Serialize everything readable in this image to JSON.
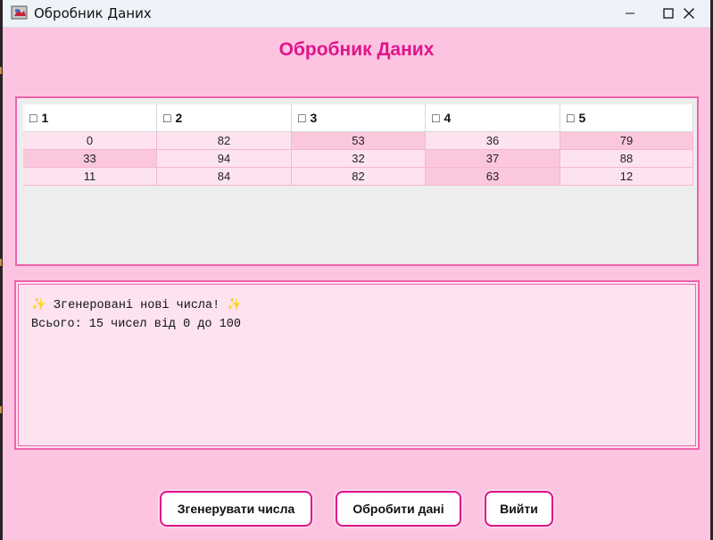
{
  "window": {
    "title": "Обробник Даних",
    "controls": [
      "minimize",
      "maximize",
      "close"
    ]
  },
  "heading": "Обробник Даних",
  "table": {
    "columns": [
      {
        "icon": "□",
        "label": "1"
      },
      {
        "icon": "□",
        "label": "2"
      },
      {
        "icon": "□",
        "label": "3"
      },
      {
        "icon": "□",
        "label": "4"
      },
      {
        "icon": "□",
        "label": "5"
      }
    ],
    "rows": [
      [
        "0",
        "82",
        "53",
        "36",
        "79"
      ],
      [
        "33",
        "94",
        "32",
        "37",
        "88"
      ],
      [
        "11",
        "84",
        "82",
        "63",
        "12"
      ]
    ]
  },
  "log": {
    "line1": "✨ Згенеровані нові числа! ✨",
    "line2": "Всього: 15 чисел від 0 до 100"
  },
  "buttons": {
    "generate": "Згенерувати числа",
    "process": "Обробити дані",
    "exit": "Вийти"
  },
  "colors": {
    "background": "#fdc4e2",
    "accent": "#e0148b",
    "border": "#ee63ab",
    "cell_light": "#fde3f0",
    "cell_dark": "#fbc7dd"
  }
}
